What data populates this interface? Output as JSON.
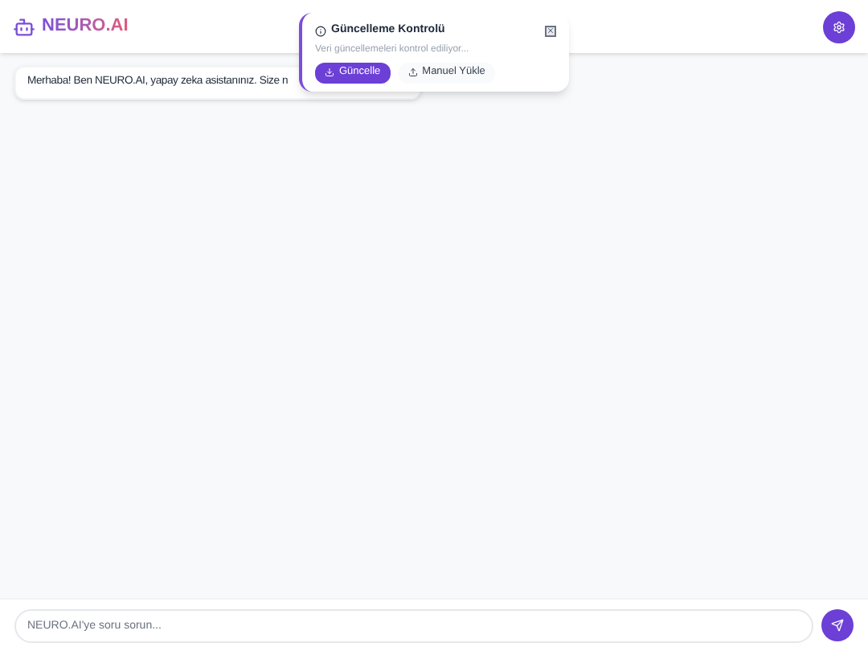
{
  "header": {
    "logo": "NEURO.AI"
  },
  "messages": [
    {
      "text": "Merhaba! Ben NEURO.AI, yapay zeka asistanınız. Size n"
    }
  ],
  "popup": {
    "title": "Güncelleme Kontrolü",
    "status": "Veri güncellemeleri kontrol ediliyor...",
    "buttons": [
      {
        "label": "Güncelle",
        "kind": "primary"
      },
      {
        "label": "Manuel Yükle",
        "kind": "secondary"
      }
    ]
  },
  "input": {
    "placeholder": "NEURO.AI'ye soru sorun..."
  }
}
